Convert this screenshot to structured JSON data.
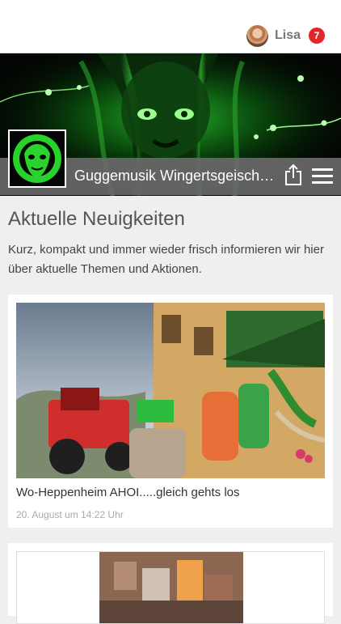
{
  "header": {
    "user_name": "Lisa",
    "notification_count": "7"
  },
  "club": {
    "title": "Guggemusik Wingertsgeischd…"
  },
  "page": {
    "heading": "Aktuelle Neuigkeiten",
    "intro": "Kurz, kompakt und immer wieder frisch informieren wir hier über aktuelle Themen und Aktionen."
  },
  "news": [
    {
      "title": "Wo-Heppenheim AHOI.....gleich gehts los",
      "date": "20. August um 14:22 Uhr"
    },
    {
      "title": "",
      "date": ""
    }
  ],
  "icons": {
    "share": "share-icon",
    "menu": "hamburger-menu-icon",
    "avatar": "user-avatar"
  },
  "colors": {
    "badge": "#e4262c",
    "banner_bar": "#696969",
    "accent_green": "#39d13a"
  }
}
